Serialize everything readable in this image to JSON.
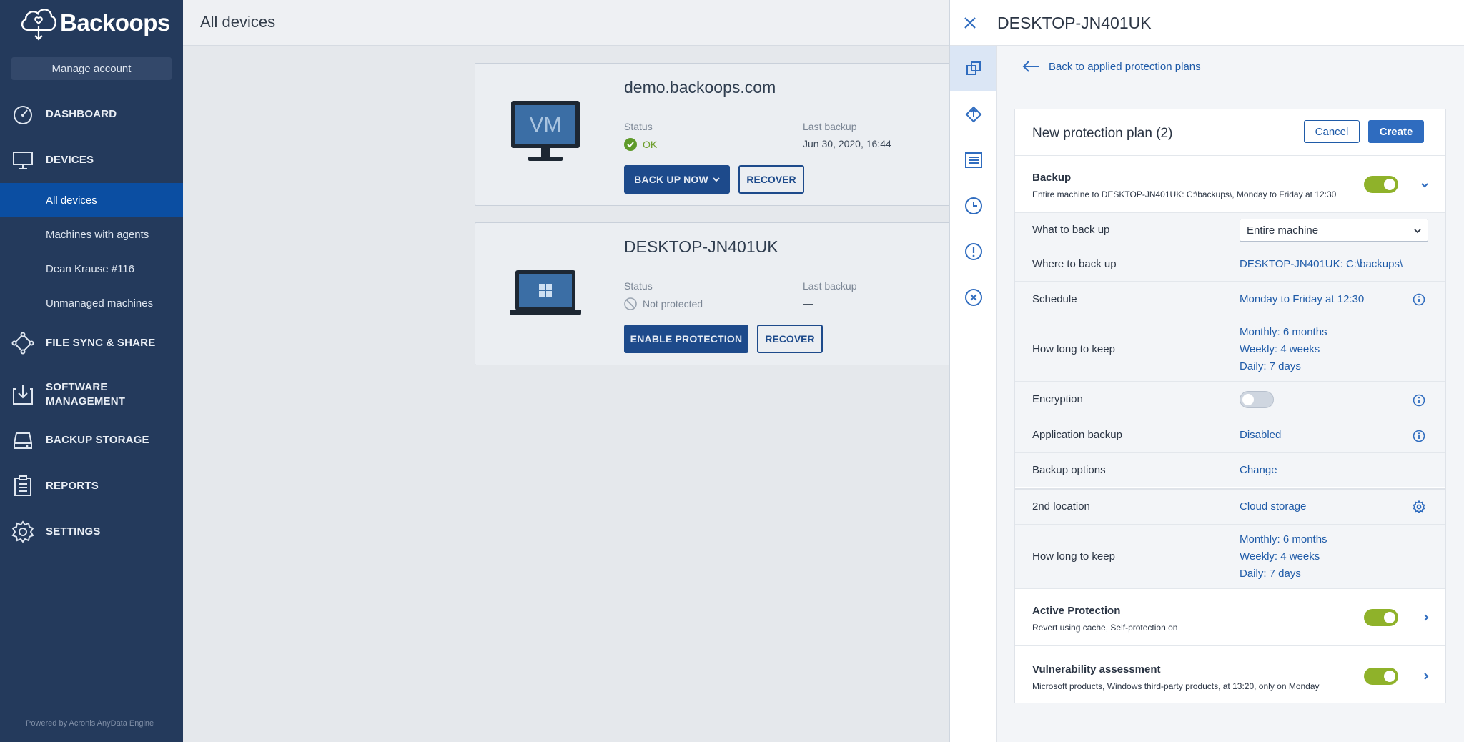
{
  "app": {
    "name": "Backoops",
    "manage_account": "Manage account",
    "powered_by": "Powered by Acronis AnyData Engine"
  },
  "sidebar": {
    "items": [
      {
        "label": "DASHBOARD",
        "icon": "dashboard-icon"
      },
      {
        "label": "DEVICES",
        "icon": "monitor-icon"
      },
      {
        "label": "FILE SYNC & SHARE",
        "icon": "share-icon"
      },
      {
        "label": "SOFTWARE\nMANAGEMENT",
        "label_line1": "SOFTWARE",
        "label_line2": "MANAGEMENT",
        "icon": "download-box-icon"
      },
      {
        "label": "BACKUP STORAGE",
        "icon": "storage-icon"
      },
      {
        "label": "REPORTS",
        "icon": "clipboard-icon"
      },
      {
        "label": "SETTINGS",
        "icon": "gear-icon"
      }
    ],
    "sub_items": [
      "All devices",
      "Machines with agents",
      "Dean Krause #116",
      "Unmanaged machines"
    ]
  },
  "main": {
    "title": "All devices",
    "devices": [
      {
        "name": "demo.backoops.com",
        "status_label": "Status",
        "status": "OK",
        "last_backup_label": "Last backup",
        "last_backup": "Jun 30, 2020, 16:44",
        "primary_btn": "BACK UP NOW",
        "secondary_btn": "RECOVER",
        "image_text": "VM"
      },
      {
        "name": "DESKTOP-JN401UK",
        "status_label": "Status",
        "status": "Not protected",
        "last_backup_label": "Last backup",
        "last_backup": "—",
        "primary_btn": "ENABLE PROTECTION",
        "secondary_btn": "RECOVER"
      }
    ]
  },
  "panel": {
    "title": "DESKTOP-JN401UK",
    "back_link": "Back to applied protection plans",
    "plan": {
      "title": "New protection plan (2)",
      "cancel": "Cancel",
      "create": "Create",
      "backup": {
        "title": "Backup",
        "summary": "Entire machine to DESKTOP-JN401UK: C:\\backups\\, Monday to Friday at 12:30",
        "enabled": true
      },
      "rows": {
        "what": {
          "label": "What to back up",
          "value": "Entire machine"
        },
        "where": {
          "label": "Where to back up",
          "value": "DESKTOP-JN401UK: C:\\backups\\"
        },
        "schedule": {
          "label": "Schedule",
          "value": "Monday to Friday at 12:30"
        },
        "keep": {
          "label": "How long to keep",
          "monthly": "Monthly: 6 months",
          "weekly": "Weekly: 4 weeks",
          "daily": "Daily: 7 days"
        },
        "encryption": {
          "label": "Encryption",
          "enabled": false
        },
        "app_backup": {
          "label": "Application backup",
          "value": "Disabled"
        },
        "options": {
          "label": "Backup options",
          "value": "Change"
        },
        "second": {
          "label": "2nd location",
          "value": "Cloud storage"
        },
        "keep2": {
          "label": "How long to keep",
          "monthly": "Monthly: 6 months",
          "weekly": "Weekly: 4 weeks",
          "daily": "Daily: 7 days"
        }
      },
      "active_protection": {
        "title": "Active Protection",
        "summary": "Revert using cache, Self-protection on",
        "enabled": true
      },
      "vulnerability": {
        "title": "Vulnerability assessment",
        "summary": "Microsoft products, Windows third-party products, at 13:20, only on Monday",
        "enabled": true
      }
    }
  },
  "colors": {
    "sidebar_bg": "#243a5c",
    "accent": "#1f5ba8",
    "active_nav": "#0b4ea2",
    "toggle_on": "#8fb22a",
    "ok_green": "#7cb32e"
  }
}
